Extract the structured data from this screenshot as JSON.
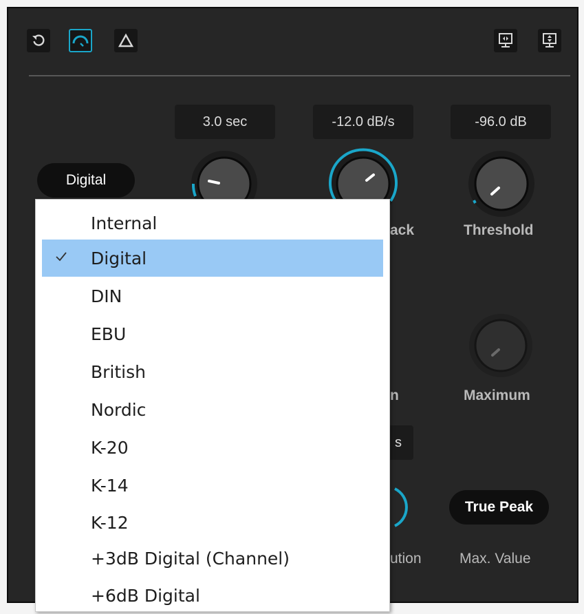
{
  "toolbar": {
    "left_buttons": [
      "reset-icon",
      "meter-gauge-icon",
      "warning-triangle-icon"
    ],
    "right_buttons": [
      "monitor-left-right-icon",
      "monitor-up-down-icon"
    ],
    "accent_color": "#1aa6c9"
  },
  "values": {
    "hold": "3.0 sec",
    "fallback": "-12.0 dB/s",
    "threshold": "-96.0 dB",
    "hidden_small": "s"
  },
  "labels": {
    "fallback_partial": "ack",
    "threshold": "Threshold",
    "partial_n": "n",
    "maximum": "Maximum",
    "resolution_partial": "ution",
    "max_value": "Max. Value"
  },
  "scale_select": {
    "value": "Digital"
  },
  "max_value_select": {
    "value": "True Peak"
  },
  "dropdown": {
    "selected": "Digital",
    "items": [
      "Internal",
      "Digital",
      "DIN",
      "EBU",
      "British",
      "Nordic",
      "K-20",
      "K-14",
      "K-12",
      "+3dB Digital (Channel)",
      "+6dB Digital"
    ],
    "highlight_color": "#99c9f5"
  }
}
